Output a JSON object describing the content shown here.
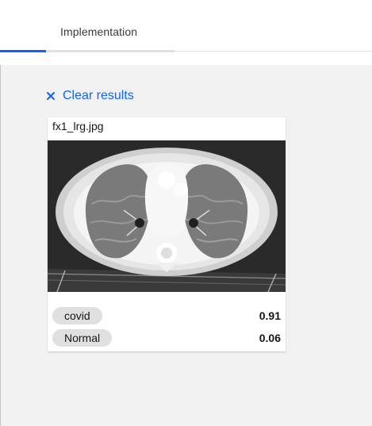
{
  "tabs": [
    {
      "label": ""
    },
    {
      "label": "Implementation"
    }
  ],
  "clear_results": {
    "label": "Clear results",
    "icon": "close-icon"
  },
  "result": {
    "filename": "fx1_lrg.jpg",
    "image": "chest-ct-scan",
    "predictions": [
      {
        "label": "covid",
        "score": "0.91"
      },
      {
        "label": "Normal",
        "score": "0.06"
      }
    ]
  },
  "colors": {
    "accent": "#0f62fe",
    "panel": "#f2f2f2",
    "pill": "#e0e0e0"
  }
}
